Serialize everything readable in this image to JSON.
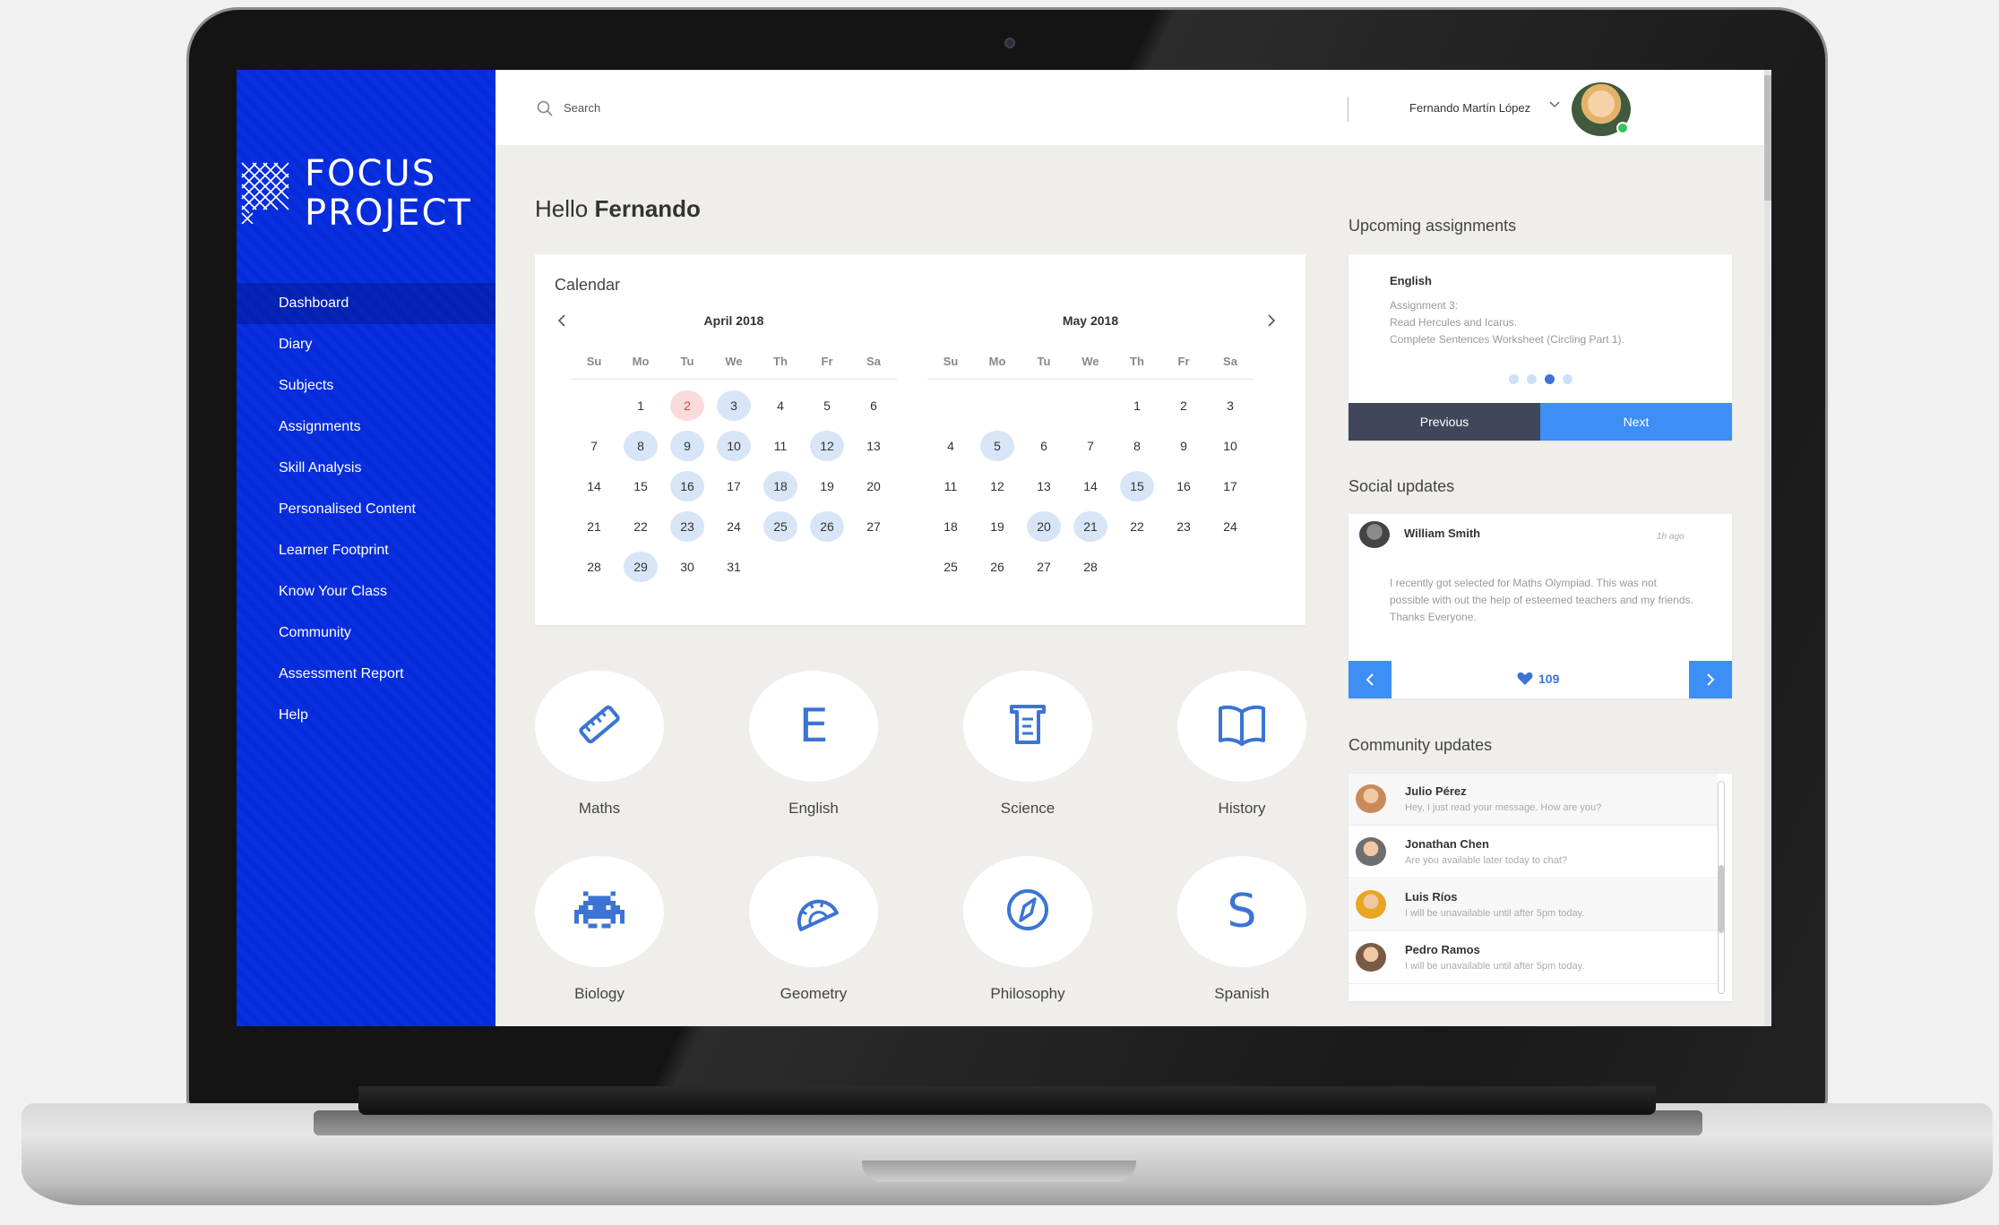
{
  "app": {
    "logo_line1": "FOCUS",
    "logo_line2": "PROJECT",
    "accent": "#062bd8",
    "button_blue": "#3d8ef5"
  },
  "sidebar": {
    "items": [
      {
        "label": "Dashboard",
        "active": true
      },
      {
        "label": "Diary"
      },
      {
        "label": "Subjects"
      },
      {
        "label": "Assignments"
      },
      {
        "label": "Skill Analysis"
      },
      {
        "label": "Personalised Content"
      },
      {
        "label": "Learner Footprint"
      },
      {
        "label": "Know Your Class"
      },
      {
        "label": "Community"
      },
      {
        "label": "Assessment Report"
      },
      {
        "label": "Help"
      }
    ]
  },
  "topbar": {
    "search_placeholder": "Search",
    "user_name": "Fernando Martín López",
    "icon": "search-icon"
  },
  "greeting": {
    "prefix": "Hello",
    "name": "Fernando"
  },
  "calendar": {
    "title": "Calendar",
    "weekdays": [
      "Su",
      "Mo",
      "Tu",
      "We",
      "Th",
      "Fr",
      "Sa"
    ],
    "months": [
      {
        "title": "April 2018",
        "offset": 1,
        "days": 31,
        "highlighted": [
          3,
          8,
          9,
          10,
          12,
          16,
          18,
          23,
          25,
          26,
          29
        ],
        "today": 2
      },
      {
        "title": "May 2018",
        "offset": 4,
        "days": 28,
        "highlighted": [
          5,
          15,
          20,
          21
        ],
        "today": null
      }
    ]
  },
  "subjects": [
    {
      "label": "Maths",
      "icon": "ruler-icon"
    },
    {
      "label": "English",
      "icon": "letter-e-icon",
      "glyph": "E"
    },
    {
      "label": "Science",
      "icon": "beaker-icon"
    },
    {
      "label": "History",
      "icon": "book-icon"
    },
    {
      "label": "Biology",
      "icon": "invader-icon"
    },
    {
      "label": "Geometry",
      "icon": "protractor-icon"
    },
    {
      "label": "Philosophy",
      "icon": "compass-icon"
    },
    {
      "label": "Spanish",
      "icon": "letter-s-icon",
      "glyph": "S"
    }
  ],
  "assignments": {
    "title": "Upcoming assignments",
    "subject": "English",
    "lines": [
      "Assignment 3:",
      "Read Hercules and Icarus.",
      "Complete Sentences Worksheet (Circling Part 1)."
    ],
    "active_dot": 3,
    "dot_count": 4,
    "prev_label": "Previous",
    "next_label": "Next"
  },
  "social": {
    "title": "Social updates",
    "author": "William Smith",
    "time": "1h ago",
    "text": "I recently got selected for Maths Olympiad. This was not possible with out the help of esteemed teachers and my friends. Thanks Everyone.",
    "likes": "109"
  },
  "community": {
    "title": "Community updates",
    "messages": [
      {
        "name": "Julio Pérez",
        "text": "Hey, I just read your message. How are you?",
        "avatar_color": "#c98a5a"
      },
      {
        "name": "Jonathan Chen",
        "text": "Are you available later today to chat?",
        "avatar_color": "#6e6e6e"
      },
      {
        "name": "Luis Ríos",
        "text": "I will be unavailable until after 5pm today.",
        "avatar_color": "#e9a524"
      },
      {
        "name": "Pedro Ramos",
        "text": "I will be unavailable until after 5pm today.",
        "avatar_color": "#7a5a45"
      }
    ]
  }
}
